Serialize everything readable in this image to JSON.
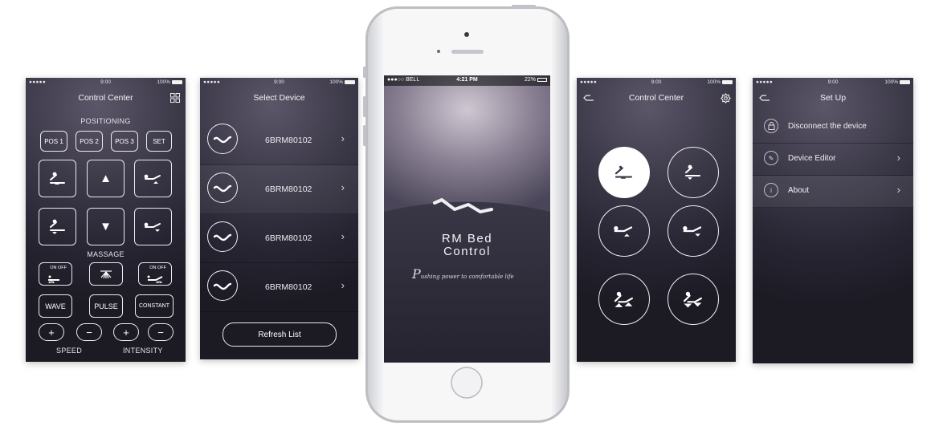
{
  "screen1": {
    "status": {
      "signal": "●●●●● ",
      "time": "9:00",
      "battery": "100%"
    },
    "title": "Control  Center",
    "positioning_label": "POSITIONING",
    "pos_buttons": [
      "POS 1",
      "POS 2",
      "POS 3",
      "SET"
    ],
    "massage_label": "MASSAGE",
    "on_off": "ON OFF",
    "mode_buttons": [
      "WAVE",
      "PULSE",
      "CONSTANT"
    ],
    "plus": "+",
    "minus": "−",
    "speed_label": "SPEED",
    "intensity_label": "INTENSITY"
  },
  "screen2": {
    "status": {
      "signal": "●●●●● ",
      "time": "9:00",
      "battery": "100%"
    },
    "title": "Select  Device",
    "devices": [
      "6BRM80102",
      "6BRM80102",
      "6BRM80102",
      "6BRM80102"
    ],
    "refresh": "Refresh List"
  },
  "phone": {
    "status": {
      "carrier": "●●●○○ BELL",
      "time": "4:21 PM",
      "battery": "22%"
    },
    "app_title_line1": "RM Bed",
    "app_title_line2": "Control",
    "tagline": "ushing power to comfortable life",
    "tagline_initial": "P"
  },
  "screen4": {
    "status": {
      "signal": "●●●●● ",
      "time": "9:00",
      "battery": "100%"
    },
    "title": "Control  Center"
  },
  "screen5": {
    "status": {
      "signal": "●●●●● ",
      "time": "9:00",
      "battery": "100%"
    },
    "title": "Set Up",
    "items": [
      {
        "label": "Disconnect the device",
        "icon": "lock-icon",
        "glyph": "🔓︎"
      },
      {
        "label": "Device Editor",
        "icon": "pencil-icon",
        "glyph": "✎"
      },
      {
        "label": "About",
        "icon": "info-icon",
        "glyph": "i"
      }
    ]
  },
  "colors": {
    "accent": "#ffffff",
    "background": "#2a2835"
  }
}
